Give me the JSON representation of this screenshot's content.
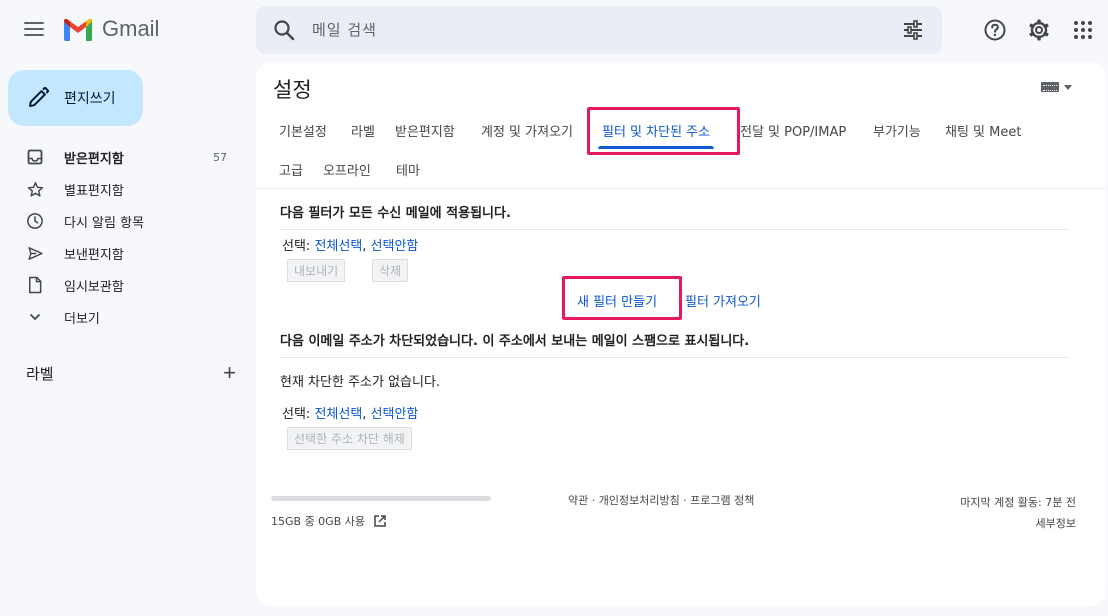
{
  "app": {
    "name": "Gmail"
  },
  "search": {
    "placeholder": "메일 검색"
  },
  "compose": {
    "label": "편지쓰기"
  },
  "sidebar": {
    "items": [
      {
        "label": "받은편지함",
        "count": "57",
        "icon": "inbox-icon"
      },
      {
        "label": "별표편지함",
        "count": "",
        "icon": "star-icon"
      },
      {
        "label": "다시 알림 항목",
        "count": "",
        "icon": "clock-icon"
      },
      {
        "label": "보낸편지함",
        "count": "",
        "icon": "send-icon"
      },
      {
        "label": "임시보관함",
        "count": "",
        "icon": "draft-icon"
      },
      {
        "label": "더보기",
        "count": "",
        "icon": "chevron-down-icon"
      }
    ],
    "labels_title": "라벨"
  },
  "settings": {
    "title": "설정",
    "tabs": [
      {
        "label": "기본설정"
      },
      {
        "label": "라벨"
      },
      {
        "label": "받은편지함"
      },
      {
        "label": "계정 및 가져오기"
      },
      {
        "label": "필터 및 차단된 주소",
        "active": true
      },
      {
        "label": "전달 및 POP/IMAP"
      },
      {
        "label": "부가기능"
      },
      {
        "label": "채팅 및 Meet"
      },
      {
        "label": "고급"
      },
      {
        "label": "오프라인"
      },
      {
        "label": "테마"
      }
    ]
  },
  "filters": {
    "heading": "다음 필터가 모든 수신 메일에 적용됩니다.",
    "select_prefix": "선택: ",
    "select_all": "전체선택",
    "comma": ", ",
    "select_none": "선택안함",
    "export_label": "내보내기",
    "delete_label": "삭제",
    "new_filter": "새 필터 만들기",
    "import_filters": "필터 가져오기"
  },
  "blocked": {
    "heading": "다음 이메일 주소가 차단되었습니다. 이 주소에서 보내는 메일이 스팸으로 표시됩니다.",
    "empty": "현재 차단한 주소가 없습니다.",
    "select_prefix": "선택: ",
    "select_all": "전체선택",
    "comma": ", ",
    "select_none": "선택안함",
    "unblock_label": "선택한 주소 차단 해제"
  },
  "footer": {
    "quota_text": "15GB 중 0GB 사용",
    "quota_fraction": 0,
    "links": "약관 · 개인정보처리방침 · 프로그램 정책",
    "last_activity": "마지막 계정 활동: 7분 전",
    "details": "세부정보"
  },
  "colors": {
    "accent": "#0b57d0",
    "highlight": "#e8185f",
    "compose_bg": "#c2e7ff"
  }
}
